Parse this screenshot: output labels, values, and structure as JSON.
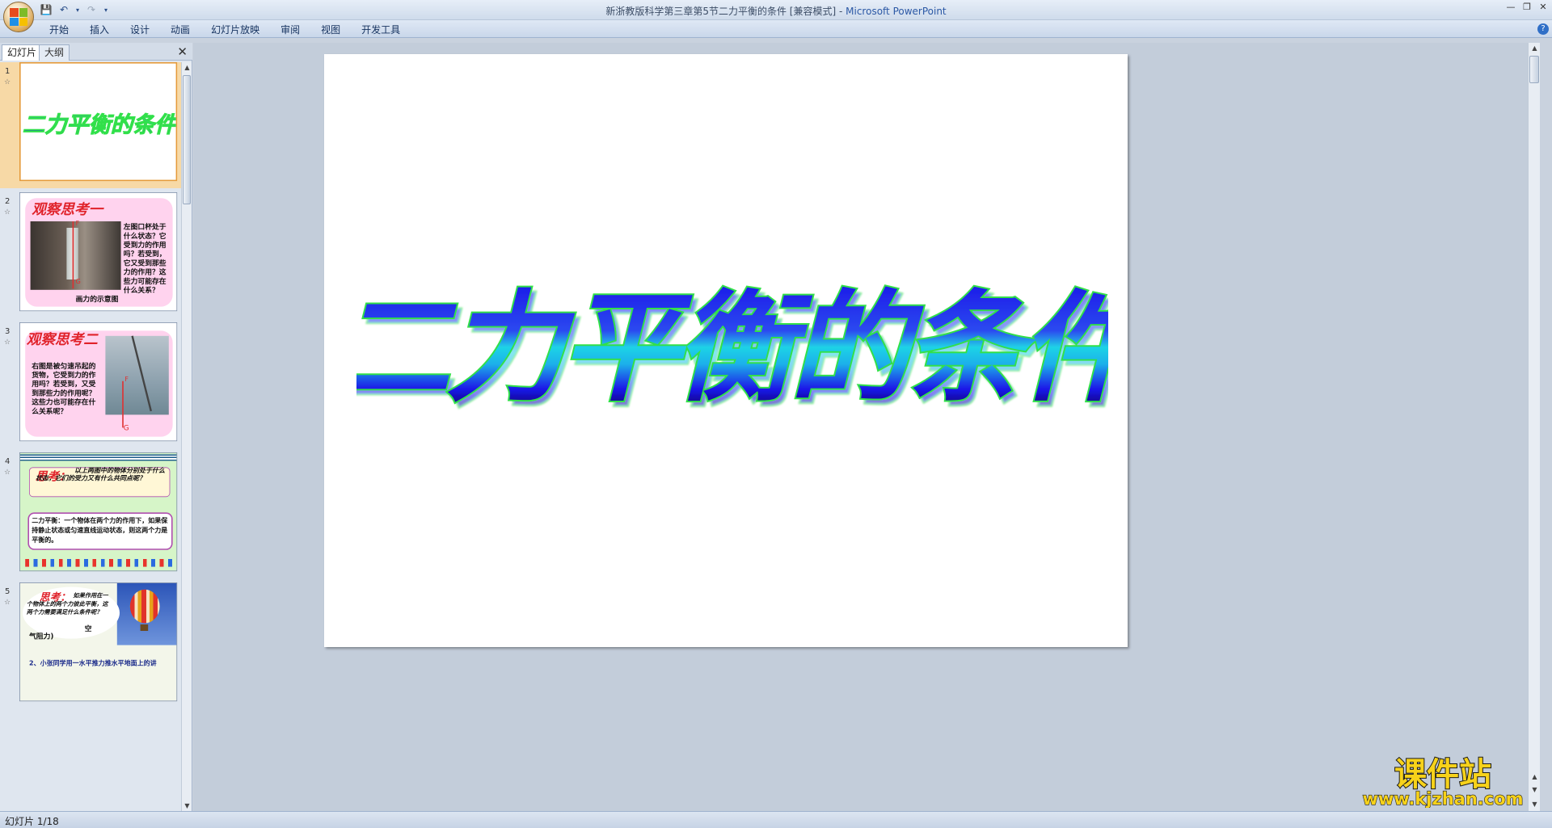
{
  "window": {
    "title": "新浙教版科学第三章第5节二力平衡的条件 [兼容模式] - ",
    "app_name": "Microsoft PowerPoint"
  },
  "ribbon": {
    "tabs": [
      "开始",
      "插入",
      "设计",
      "动画",
      "幻灯片放映",
      "审阅",
      "视图",
      "开发工具"
    ]
  },
  "left_pane": {
    "tabs": [
      "幻灯片",
      "大纲"
    ],
    "thumbnails": [
      {
        "number": "1",
        "title": "二力平衡的条件"
      },
      {
        "number": "2",
        "heading": "观察思考一",
        "body": "左图口杯处于什么状态？它受到力的作用吗？若受到，它又受到那些力的作用？这些力可能存在什么关系？",
        "caption": "画力的示意图",
        "label_f": "F",
        "label_g": "G"
      },
      {
        "number": "3",
        "heading": "观察思考二",
        "body": "右图是被匀速吊起的货物，它受到力的作用吗？若受到，又受到那些力的作用呢？这些力也可能存在什么关系呢？",
        "label_f": "F",
        "label_g": "G"
      },
      {
        "number": "4",
        "think": "思考：",
        "think_text": "以上两图中的物体分别处于什么状态，它们的受力又有什么共同点呢？",
        "def_lead": "二力平衡：",
        "def_text": "一个物体在两个力的作用下，如果保持静止状态或匀速直线运动状态，则这两个力是平衡的。"
      },
      {
        "number": "5",
        "think": "思考：",
        "think_text": "如果作用在一个物体上的两个力彼此平衡，这两个力需要满足什么条件呢？",
        "peek1": "空",
        "peek2": "气阻力)",
        "bottom": "2、小张同学用一水平推力推水平地面上的讲"
      }
    ]
  },
  "slide": {
    "title": "二力平衡的条件"
  },
  "watermark": {
    "line1": "课件站",
    "line2": "www.kjzhan.com"
  },
  "status": {
    "slide_counter": "幻灯片 1/18"
  },
  "colors": {
    "title_blue": "#1a14e8",
    "title_cyan": "#1fd3e6",
    "title_outline": "#31e04a",
    "watermark_yellow": "#f7d21a",
    "selection_orange": "#f7d9a6"
  }
}
